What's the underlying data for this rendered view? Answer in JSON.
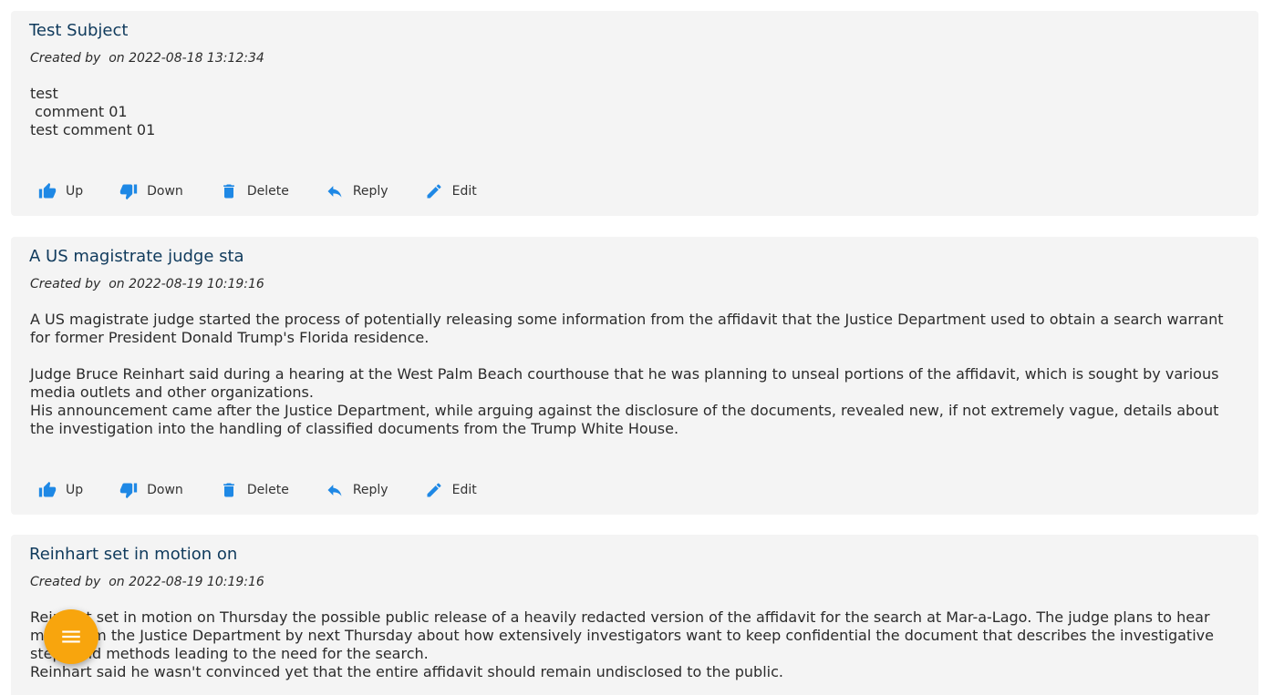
{
  "colors": {
    "card_background": "#f4f4f4",
    "title": "#0f3a5c",
    "action_icon": "#1e88e5",
    "fab": "#f8a50d"
  },
  "actions": {
    "up": "Up",
    "down": "Down",
    "delete": "Delete",
    "reply": "Reply",
    "edit": "Edit"
  },
  "posts": [
    {
      "title": "Test Subject",
      "meta": "Created by  on 2022-08-18 13:12:34",
      "body": [
        "test\n comment 01\ntest comment 01"
      ]
    },
    {
      "title": "A US magistrate judge sta",
      "meta": "Created by  on 2022-08-19 10:19:16",
      "body": [
        "A US magistrate judge started the process of potentially releasing some information from the affidavit that the Justice Department used to obtain a search warrant for former President Donald Trump's Florida residence.",
        "",
        "Judge Bruce Reinhart said during a hearing at the West Palm Beach courthouse that he was planning to unseal portions of the affidavit, which is sought by various media outlets and other organizations.",
        "His announcement came after the Justice Department, while arguing against the disclosure of the documents, revealed new, if not extremely vague, details about the investigation into the handling of classified documents from the Trump White House."
      ]
    },
    {
      "title": "Reinhart set in motion on",
      "meta": "Created by  on 2022-08-19 10:19:16",
      "body": [
        "Reinhart set in motion on Thursday the possible public release of a heavily redacted version of the affidavit for the search at Mar-a-Lago. The judge plans to hear more from the Justice Department by next Thursday about how extensively investigators want to keep confidential the document that describes the investigative steps and methods leading to the need for the search.",
        "Reinhart said he wasn't convinced yet that the entire affidavit should remain undisclosed to the public."
      ]
    }
  ],
  "fab_icon": "menu-icon"
}
